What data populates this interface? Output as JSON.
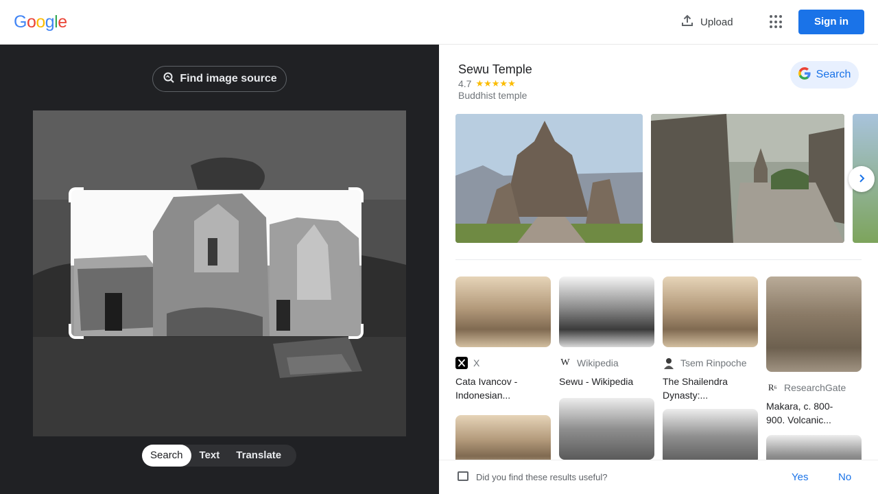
{
  "header": {
    "logo_letters": [
      {
        "char": "G",
        "color": "#4285f4"
      },
      {
        "char": "o",
        "color": "#ea4335"
      },
      {
        "char": "o",
        "color": "#fbbc05"
      },
      {
        "char": "g",
        "color": "#4285f4"
      },
      {
        "char": "l",
        "color": "#34a853"
      },
      {
        "char": "e",
        "color": "#ea4335"
      }
    ],
    "upload_label": "Upload",
    "apps_icon": "apps-grid-icon",
    "signin_label": "Sign in",
    "accent": "#1a73e8"
  },
  "left_panel": {
    "find_source_label": "Find image source",
    "modes": [
      "Search",
      "Text",
      "Translate"
    ],
    "active_mode": "Search"
  },
  "knowledge_panel": {
    "title": "Sewu Temple",
    "rating": "4.7",
    "stars_filled": 4.5,
    "stars_glyphs": "★★★★★",
    "subtitle": "Buddhist temple",
    "search_button_label": "Search"
  },
  "results": [
    {
      "source": "X",
      "source_icon": "x-logo-icon",
      "title_line1": "Cata Ivancov -",
      "title_line2": "Indonesian..."
    },
    {
      "source": "Wikipedia",
      "source_icon": "wikipedia-icon",
      "title_line1": "Sewu - Wikipedia",
      "title_line2": ""
    },
    {
      "source": "Tsem Rinpoche",
      "source_icon": "tsem-rinpoche-avatar-icon",
      "title_line1": "The Shailendra",
      "title_line2": "Dynasty:..."
    },
    {
      "source": "ResearchGate",
      "source_icon": "researchgate-icon",
      "title_line1": "Makara, c. 800-",
      "title_line2": "900. Volcanic..."
    }
  ],
  "feedback": {
    "question": "Did you find these results useful?",
    "yes_label": "Yes",
    "no_label": "No"
  }
}
